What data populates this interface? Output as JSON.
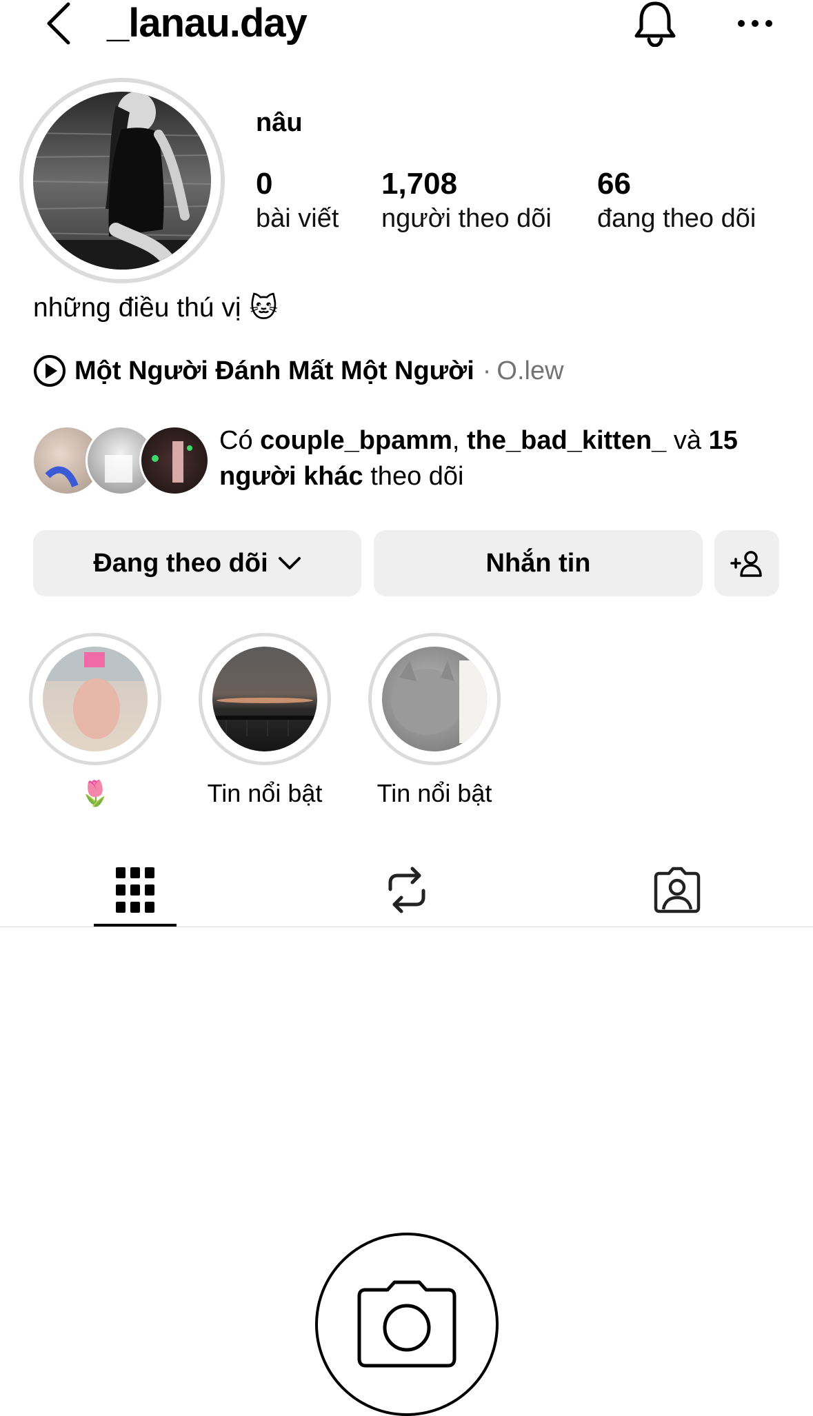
{
  "header": {
    "username": "_lanau.day",
    "back_icon": "chevron-left-icon",
    "bell_icon": "bell-icon",
    "more_icon": "ellipsis-icon"
  },
  "profile": {
    "display_name": "nâu",
    "stats": [
      {
        "value": "0",
        "label": "bài viết"
      },
      {
        "value": "1,708",
        "label": "người theo dõi"
      },
      {
        "value": "66",
        "label": "đang theo dõi"
      }
    ],
    "bio": "những điều thú vị",
    "bio_emoji": "🐱",
    "music": {
      "title": "Một Người Đánh Mất Một Người",
      "separator": "·",
      "artist": "O.lew"
    }
  },
  "followed_by": {
    "prefix": "Có",
    "user1": "couple_bpamm",
    "comma": ",",
    "user2": "the_bad_kitten_",
    "and": "và",
    "others": "15 người khác",
    "suffix": "theo dõi"
  },
  "actions": {
    "following_label": "Đang theo dõi",
    "message_label": "Nhắn tin",
    "add_person_icon": "add-person-icon"
  },
  "highlights": [
    {
      "label": "🌷"
    },
    {
      "label": "Tin nổi bật"
    },
    {
      "label": "Tin nổi bật"
    }
  ],
  "tabs": [
    {
      "icon": "grid-icon",
      "active": true
    },
    {
      "icon": "reels-repost-icon",
      "active": false
    },
    {
      "icon": "tagged-icon",
      "active": false
    }
  ],
  "colors": {
    "button_bg": "#efefef",
    "ring": "#dbdbdb",
    "muted_text": "#737373"
  }
}
